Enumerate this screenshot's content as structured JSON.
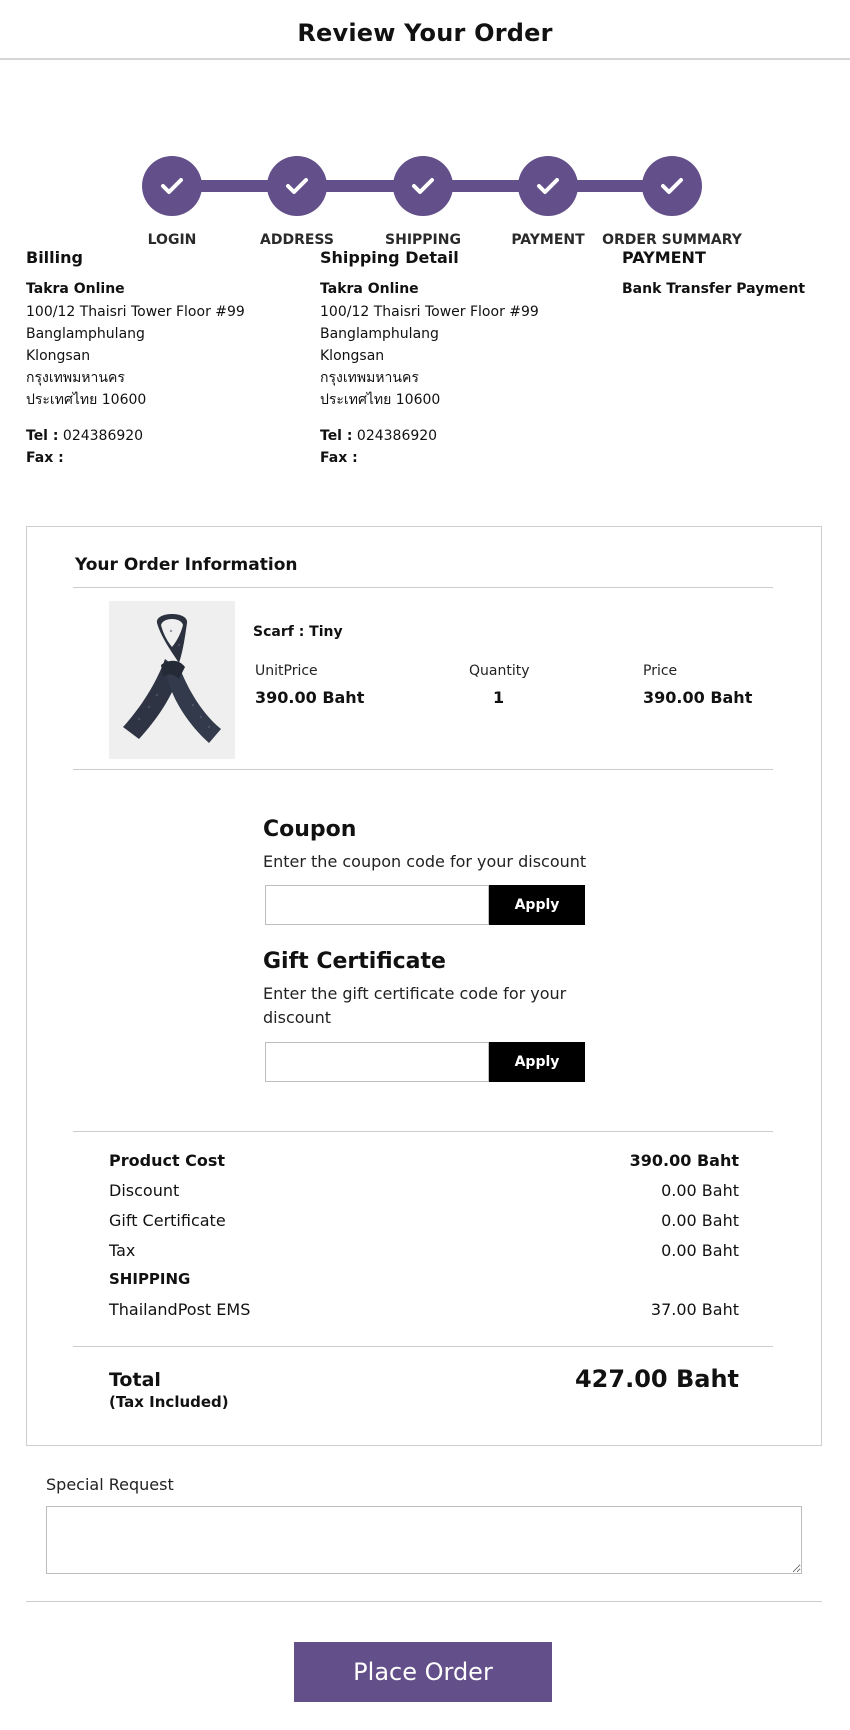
{
  "page_title": "Review Your Order",
  "steps": [
    {
      "label": "LOGIN"
    },
    {
      "label": "ADDRESS"
    },
    {
      "label": "SHIPPING"
    },
    {
      "label": "PAYMENT"
    },
    {
      "label": "ORDER SUMMARY"
    }
  ],
  "billing": {
    "heading": "Billing",
    "company": "Takra Online",
    "lines": [
      "100/12 Thaisri Tower Floor #99",
      "Banglamphulang",
      "Klongsan",
      "กรุงเทพมหานคร",
      "ประเทศไทย 10600"
    ],
    "tel_label": "Tel :",
    "tel": "024386920",
    "fax_label": "Fax :"
  },
  "shipping_detail": {
    "heading": "Shipping Detail",
    "company": "Takra Online",
    "lines": [
      "100/12 Thaisri Tower Floor #99",
      "Banglamphulang",
      "Klongsan",
      "กรุงเทพมหานคร",
      "ประเทศไทย 10600"
    ],
    "tel_label": "Tel :",
    "tel": "024386920",
    "fax_label": "Fax :"
  },
  "payment": {
    "heading": "PAYMENT",
    "method": "Bank Transfer Payment"
  },
  "order": {
    "heading": "Your Order Information",
    "product": {
      "name": "Scarf : Tiny",
      "unit_price_label": "UnitPrice",
      "unit_price": "390.00 Baht",
      "quantity_label": "Quantity",
      "quantity": "1",
      "price_label": "Price",
      "price": "390.00 Baht"
    },
    "coupon": {
      "heading": "Coupon",
      "description": "Enter the coupon code for your discount",
      "value": "",
      "apply_label": "Apply"
    },
    "gift": {
      "heading": "Gift Certificate",
      "description": "Enter the gift certificate code for your discount",
      "value": "",
      "apply_label": "Apply"
    },
    "summary": {
      "product_cost_label": "Product Cost",
      "product_cost": "390.00 Baht",
      "discount_label": "Discount",
      "discount": "0.00 Baht",
      "gift_label": "Gift Certificate",
      "gift": "0.00 Baht",
      "tax_label": "Tax",
      "tax": "0.00 Baht",
      "shipping_heading": "SHIPPING",
      "shipping_method": "ThailandPost EMS",
      "shipping_cost": "37.00 Baht"
    },
    "total": {
      "label": "Total",
      "sub_label": "(Tax Included)",
      "value": "427.00 Baht"
    }
  },
  "special_request": {
    "label": "Special Request",
    "value": ""
  },
  "place_order_label": "Place Order",
  "colors": {
    "accent": "#634f89",
    "button_dark": "#000000"
  }
}
